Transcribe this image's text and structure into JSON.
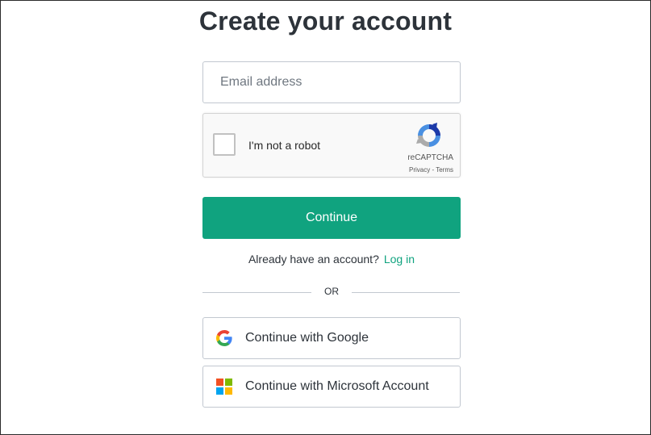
{
  "page": {
    "title": "Create your account"
  },
  "email": {
    "placeholder": "Email address",
    "value": ""
  },
  "recaptcha": {
    "label": "I'm not a robot",
    "brand": "reCAPTCHA",
    "privacy": "Privacy",
    "separator": " - ",
    "terms": "Terms",
    "checked": false
  },
  "continue_button": {
    "label": "Continue",
    "color": "#10a37f"
  },
  "login_prompt": {
    "text": "Already have an account?",
    "link": "Log in"
  },
  "divider": {
    "label": "OR"
  },
  "social": {
    "google": {
      "label": "Continue with Google",
      "icon": "google-icon"
    },
    "microsoft": {
      "label": "Continue with Microsoft Account",
      "icon": "microsoft-icon"
    }
  },
  "colors": {
    "accent": "#10a37f",
    "text": "#2d333a",
    "border": "#c2c8d0"
  }
}
